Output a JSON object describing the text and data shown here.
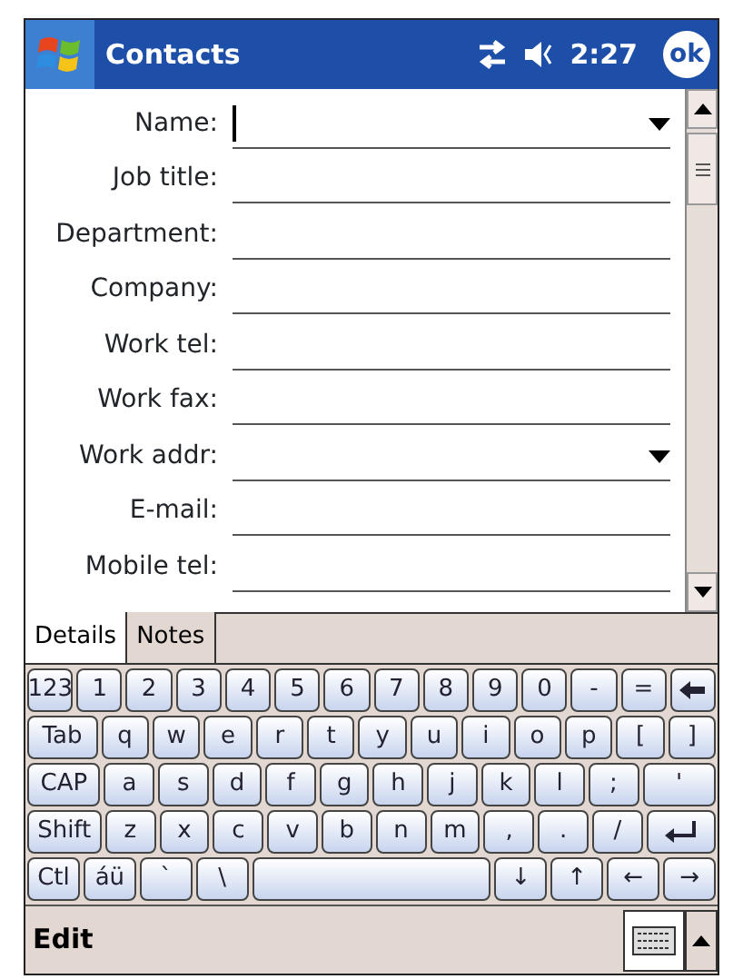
{
  "title_bar": {
    "title": "Contacts",
    "time": "2:27",
    "ok": "ok"
  },
  "fields": [
    {
      "label": "Name:",
      "kind": "dropdown",
      "focused": true
    },
    {
      "label": "Job title:",
      "kind": "text",
      "focused": false
    },
    {
      "label": "Department:",
      "kind": "text",
      "focused": false
    },
    {
      "label": "Company:",
      "kind": "text",
      "focused": false
    },
    {
      "label": "Work tel:",
      "kind": "text",
      "focused": false
    },
    {
      "label": "Work fax:",
      "kind": "text",
      "focused": false
    },
    {
      "label": "Work addr:",
      "kind": "dropdown",
      "focused": false
    },
    {
      "label": "E-mail:",
      "kind": "text",
      "focused": false
    },
    {
      "label": "Mobile tel:",
      "kind": "text",
      "focused": false
    }
  ],
  "tabs": [
    {
      "label": "Details",
      "selected": true
    },
    {
      "label": "Notes",
      "selected": false
    }
  ],
  "keyboard": [
    [
      {
        "label": "123"
      },
      {
        "label": "1"
      },
      {
        "label": "2"
      },
      {
        "label": "3"
      },
      {
        "label": "4"
      },
      {
        "label": "5"
      },
      {
        "label": "6"
      },
      {
        "label": "7"
      },
      {
        "label": "8"
      },
      {
        "label": "9"
      },
      {
        "label": "0"
      },
      {
        "label": "-"
      },
      {
        "label": "="
      },
      {
        "kind": "backspace"
      }
    ],
    [
      {
        "label": "Tab",
        "kind": "modifier"
      },
      {
        "label": "q"
      },
      {
        "label": "w"
      },
      {
        "label": "e"
      },
      {
        "label": "r"
      },
      {
        "label": "t"
      },
      {
        "label": "y"
      },
      {
        "label": "u"
      },
      {
        "label": "i"
      },
      {
        "label": "o"
      },
      {
        "label": "p"
      },
      {
        "label": "["
      },
      {
        "label": "]"
      }
    ],
    [
      {
        "label": "CAP",
        "kind": "modifier"
      },
      {
        "label": "a"
      },
      {
        "label": "s"
      },
      {
        "label": "d"
      },
      {
        "label": "f"
      },
      {
        "label": "g"
      },
      {
        "label": "h"
      },
      {
        "label": "j"
      },
      {
        "label": "k"
      },
      {
        "label": "l"
      },
      {
        "label": ";"
      },
      {
        "label": "'",
        "kind": "modifier"
      }
    ],
    [
      {
        "label": "Shift",
        "kind": "modifier"
      },
      {
        "label": "z"
      },
      {
        "label": "x"
      },
      {
        "label": "c"
      },
      {
        "label": "v"
      },
      {
        "label": "b"
      },
      {
        "label": "n"
      },
      {
        "label": "m"
      },
      {
        "label": ","
      },
      {
        "label": "."
      },
      {
        "label": "/"
      },
      {
        "kind": "enter"
      }
    ],
    [
      {
        "label": "Ctl"
      },
      {
        "label": "áü"
      },
      {
        "label": "`"
      },
      {
        "label": "\\"
      },
      {
        "kind": "space"
      },
      {
        "label": "↓"
      },
      {
        "label": "↑"
      },
      {
        "label": "←"
      },
      {
        "label": "→"
      }
    ]
  ],
  "menu_bar": {
    "menu": "Edit"
  }
}
